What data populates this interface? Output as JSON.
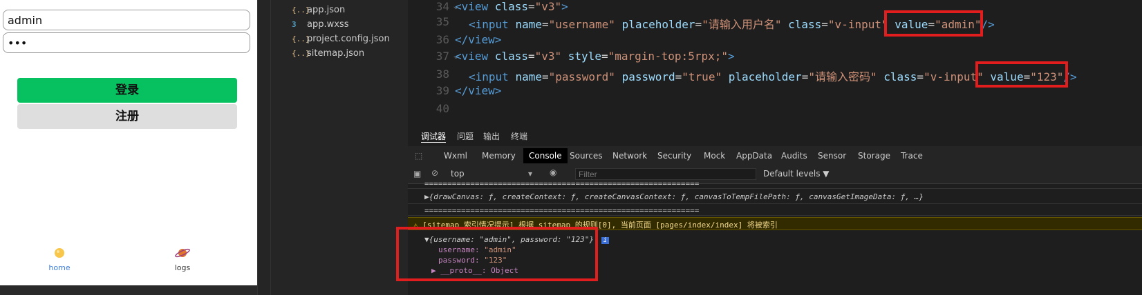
{
  "simulator": {
    "username_value": "admin",
    "password_value": "•••",
    "login_label": "登录",
    "register_label": "注册",
    "tabs": [
      {
        "label": "home",
        "color": "#3c7dd9"
      },
      {
        "label": "logs",
        "color": "#333333"
      }
    ]
  },
  "files": [
    {
      "icon": "{..}",
      "name": "app.json"
    },
    {
      "icon": "3",
      "name": "app.wxss"
    },
    {
      "icon": "{..}",
      "name": "project.config.json"
    },
    {
      "icon": "{..}",
      "name": "sitemap.json"
    }
  ],
  "editor": {
    "lines": [
      {
        "n": "34",
        "tokens": [
          [
            "t",
            "<view "
          ],
          [
            "a",
            "class"
          ],
          [
            "p",
            "="
          ],
          [
            "s",
            "\"v3\""
          ],
          [
            "t",
            ">"
          ]
        ]
      },
      {
        "n": "35",
        "tokens": [
          [
            "t",
            "<input "
          ],
          [
            "a",
            "name"
          ],
          [
            "p",
            "="
          ],
          [
            "s",
            "\"username\""
          ],
          [
            "p",
            " "
          ],
          [
            "a",
            "placeholder"
          ],
          [
            "p",
            "="
          ],
          [
            "s",
            "\"请输入用户名\""
          ],
          [
            "p",
            " "
          ],
          [
            "a",
            "class"
          ],
          [
            "p",
            "="
          ],
          [
            "s",
            "\"v-input\""
          ],
          [
            "p",
            " "
          ],
          [
            "a",
            "value"
          ],
          [
            "p",
            "="
          ],
          [
            "s",
            "\"admin\""
          ],
          [
            "t",
            "/>"
          ]
        ]
      },
      {
        "n": "36",
        "tokens": [
          [
            "t",
            "</view>"
          ]
        ]
      },
      {
        "n": "37",
        "tokens": [
          [
            "t",
            "<view "
          ],
          [
            "a",
            "class"
          ],
          [
            "p",
            "="
          ],
          [
            "s",
            "\"v3\""
          ],
          [
            "p",
            " "
          ],
          [
            "a",
            "style"
          ],
          [
            "p",
            "="
          ],
          [
            "s",
            "\"margin-top:5rpx;\""
          ],
          [
            "t",
            ">"
          ]
        ]
      },
      {
        "n": "38",
        "tokens": [
          [
            "t",
            "<input "
          ],
          [
            "a",
            "name"
          ],
          [
            "p",
            "="
          ],
          [
            "s",
            "\"password\""
          ],
          [
            "p",
            " "
          ],
          [
            "a",
            "password"
          ],
          [
            "p",
            "="
          ],
          [
            "s",
            "\"true\""
          ],
          [
            "p",
            " "
          ],
          [
            "a",
            "placeholder"
          ],
          [
            "p",
            "="
          ],
          [
            "s",
            "\"请输入密码\""
          ],
          [
            "p",
            " "
          ],
          [
            "a",
            "class"
          ],
          [
            "p",
            "="
          ],
          [
            "s",
            "\"v-input\""
          ],
          [
            "p",
            " "
          ],
          [
            "a",
            "value"
          ],
          [
            "p",
            "="
          ],
          [
            "s",
            "\"123\""
          ],
          [
            "t",
            "/>"
          ]
        ]
      },
      {
        "n": "39",
        "tokens": [
          [
            "t",
            "</view>"
          ]
        ]
      },
      {
        "n": "40",
        "tokens": []
      }
    ]
  },
  "devtools": {
    "top_tabs": [
      "调试器",
      "问题",
      "输出",
      "终端"
    ],
    "panel_tabs": [
      "Wxml",
      "Memory",
      "Console",
      "Sources",
      "Network",
      "Security",
      "Mock",
      "AppData",
      "Audits",
      "Sensor",
      "Storage",
      "Trace"
    ],
    "active_panel": "Console",
    "context": "top",
    "filter_placeholder": "Filter",
    "levels": "Default levels ▼",
    "console": {
      "sep1": "============================================================",
      "obj1": "▶{drawCanvas: ƒ, createContext: ƒ, createCanvasContext: ƒ, canvasToTempFilePath: ƒ, canvasGetImageData: ƒ, …}",
      "sep2": "============================================================",
      "warning": "[sitemap 索引情况提示] 根据 sitemap 的规则[0], 当前页面 [pages/index/index] 将被索引",
      "obj2_head": "▼{username: \"admin\", password: \"123\"}",
      "obj2_username_key": "username:",
      "obj2_username_val": "\"admin\"",
      "obj2_password_key": "password:",
      "obj2_password_val": "\"123\"",
      "obj2_proto": "▶ __proto__: Object"
    }
  },
  "colors": {
    "accent_green": "#07c160",
    "highlight_red": "#e21d1d"
  }
}
